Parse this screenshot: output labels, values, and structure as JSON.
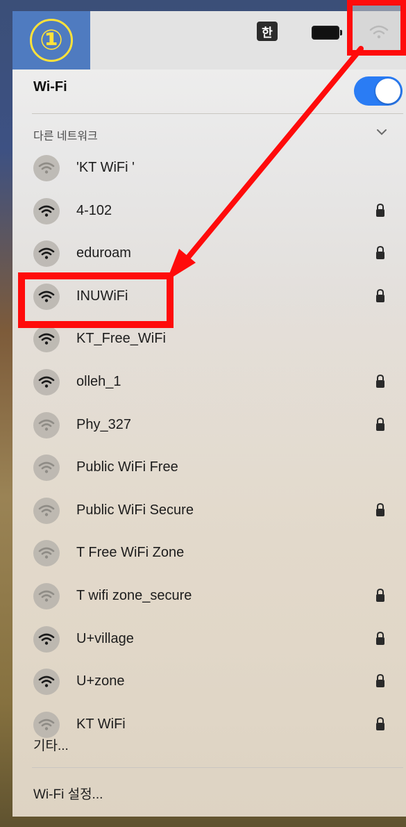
{
  "menubar": {
    "step_badge": "①",
    "input_indicator": "한",
    "battery_icon": "battery-icon",
    "wifi_icon": "wifi-icon"
  },
  "panel": {
    "title": "Wi-Fi",
    "toggle_on": true,
    "section_label": "다른 네트워크",
    "networks": [
      {
        "name": "'KT WiFi '",
        "locked": false,
        "strength": "weak"
      },
      {
        "name": "4-102",
        "locked": true,
        "strength": "strong"
      },
      {
        "name": "eduroam",
        "locked": true,
        "strength": "strong"
      },
      {
        "name": "INUWiFi",
        "locked": true,
        "strength": "strong"
      },
      {
        "name": "KT_Free_WiFi",
        "locked": false,
        "strength": "strong"
      },
      {
        "name": "olleh_1",
        "locked": true,
        "strength": "strong"
      },
      {
        "name": "Phy_327",
        "locked": true,
        "strength": "weak"
      },
      {
        "name": "Public WiFi Free",
        "locked": false,
        "strength": "weak"
      },
      {
        "name": "Public WiFi Secure",
        "locked": true,
        "strength": "weak"
      },
      {
        "name": "T Free WiFi Zone",
        "locked": false,
        "strength": "weak"
      },
      {
        "name": "T wifi zone_secure",
        "locked": true,
        "strength": "weak"
      },
      {
        "name": "U+village",
        "locked": true,
        "strength": "strong"
      },
      {
        "name": "U+zone",
        "locked": true,
        "strength": "strong"
      },
      {
        "name": "KT WiFi",
        "locked": true,
        "strength": "weak"
      }
    ],
    "other_label": "기타...",
    "settings_label": "Wi-Fi 설정..."
  },
  "annotation": {
    "highlight_color": "#ff0b0b",
    "highlighted_network": "INUWiFi"
  }
}
